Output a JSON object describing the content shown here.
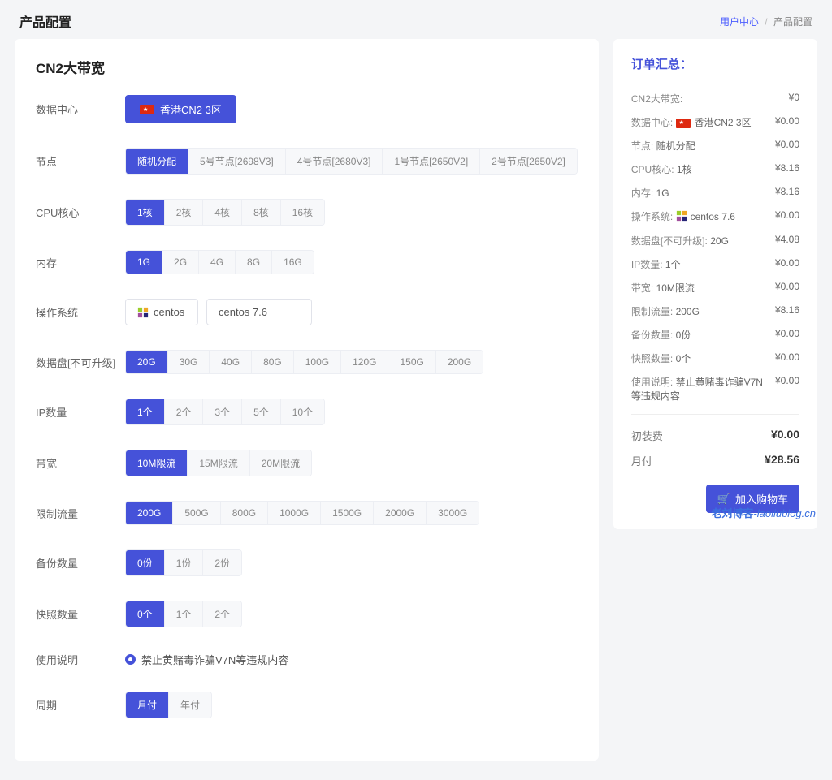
{
  "header": {
    "title": "产品配置",
    "breadcrumb": {
      "link": "用户中心",
      "sep": "/",
      "current": "产品配置"
    }
  },
  "main": {
    "title": "CN2大带宽",
    "rows": {
      "datacenter": {
        "label": "数据中心",
        "value": "香港CN2 3区"
      },
      "node": {
        "label": "节点",
        "options": [
          "随机分配",
          "5号节点[2698V3]",
          "4号节点[2680V3]",
          "1号节点[2650V2]",
          "2号节点[2650V2]"
        ],
        "selected": 0
      },
      "cpu": {
        "label": "CPU核心",
        "options": [
          "1核",
          "2核",
          "4核",
          "8核",
          "16核"
        ],
        "selected": 0
      },
      "mem": {
        "label": "内存",
        "options": [
          "1G",
          "2G",
          "4G",
          "8G",
          "16G"
        ],
        "selected": 0
      },
      "os": {
        "label": "操作系统",
        "family": "centos",
        "version": "centos 7.6"
      },
      "disk": {
        "label": "数据盘[不可升级]",
        "options": [
          "20G",
          "30G",
          "40G",
          "80G",
          "100G",
          "120G",
          "150G",
          "200G"
        ],
        "selected": 0
      },
      "ip": {
        "label": "IP数量",
        "options": [
          "1个",
          "2个",
          "3个",
          "5个",
          "10个"
        ],
        "selected": 0
      },
      "bw": {
        "label": "带宽",
        "options": [
          "10M限流",
          "15M限流",
          "20M限流"
        ],
        "selected": 0
      },
      "traffic": {
        "label": "限制流量",
        "options": [
          "200G",
          "500G",
          "800G",
          "1000G",
          "1500G",
          "2000G",
          "3000G"
        ],
        "selected": 0
      },
      "backup": {
        "label": "备份数量",
        "options": [
          "0份",
          "1份",
          "2份"
        ],
        "selected": 0
      },
      "snap": {
        "label": "快照数量",
        "options": [
          "0个",
          "1个",
          "2个"
        ],
        "selected": 0
      },
      "note": {
        "label": "使用说明",
        "value": "禁止黄赌毒诈骗V7N等违规内容"
      },
      "period": {
        "label": "周期",
        "options": [
          "月付",
          "年付"
        ],
        "selected": 0
      }
    }
  },
  "side": {
    "title": "订单汇总：",
    "rows": [
      {
        "k": "CN2大带宽:",
        "v": "¥0"
      },
      {
        "k": "数据中心:",
        "flag": true,
        "extra": "香港CN2 3区",
        "v": "¥0.00"
      },
      {
        "k": "节点:",
        "extra": "随机分配",
        "v": "¥0.00"
      },
      {
        "k": "CPU核心:",
        "extra": "1核",
        "v": "¥8.16"
      },
      {
        "k": "内存:",
        "extra": "1G",
        "v": "¥8.16"
      },
      {
        "k": "操作系统:",
        "osicon": true,
        "extra": "centos 7.6",
        "v": "¥0.00"
      },
      {
        "k": "数据盘[不可升级]:",
        "extra": "20G",
        "v": "¥4.08"
      },
      {
        "k": "IP数量:",
        "extra": "1个",
        "v": "¥0.00"
      },
      {
        "k": "带宽:",
        "extra": "10M限流",
        "v": "¥0.00"
      },
      {
        "k": "限制流量:",
        "extra": "200G",
        "v": "¥8.16"
      },
      {
        "k": "备份数量:",
        "extra": "0份",
        "v": "¥0.00"
      },
      {
        "k": "快照数量:",
        "extra": "0个",
        "v": "¥0.00"
      },
      {
        "k": "使用说明:",
        "extra": "禁止黄赌毒诈骗V7N等违规内容",
        "v": "¥0.00"
      }
    ],
    "totals": [
      {
        "k": "初装费",
        "v": "¥0.00"
      },
      {
        "k": "月付",
        "v": "¥28.56"
      }
    ],
    "cart": "加入购物车"
  },
  "watermark": {
    "bold": "老刘博客",
    "rest": "-laoliublog.cn"
  }
}
